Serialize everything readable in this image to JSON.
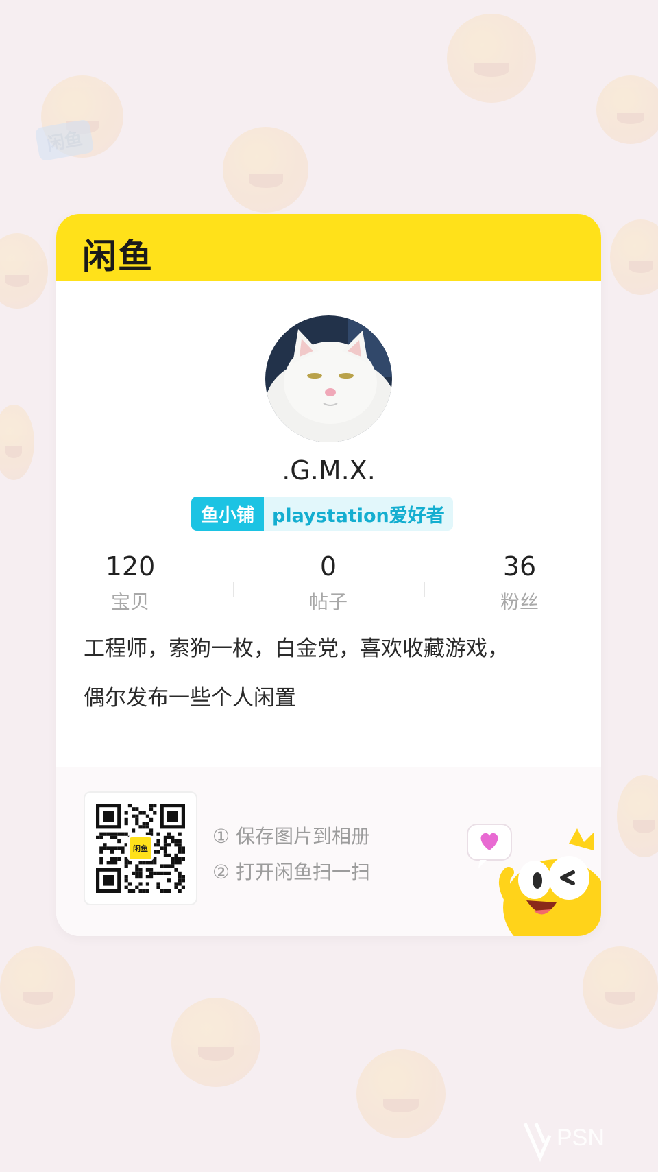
{
  "brand": {
    "name": "闲鱼",
    "bg_tag": "闲鱼"
  },
  "profile": {
    "username": ".G.M.X.",
    "badge_shop": "鱼小铺",
    "badge_tag": "playstation爱好者"
  },
  "stats": [
    {
      "value": "120",
      "label": "宝贝"
    },
    {
      "value": "0",
      "label": "帖子"
    },
    {
      "value": "36",
      "label": "粉丝"
    }
  ],
  "bio": {
    "line1": "工程师，索狗一枚，白金党，喜欢收藏游戏，",
    "line2": "偶尔发布一些个人闲置"
  },
  "footer": {
    "step1": "① 保存图片到相册",
    "step2": "② 打开闲鱼扫一扫",
    "qr_label": "闲鱼"
  },
  "watermark": {
    "text": "PSN"
  },
  "colors": {
    "brand_yellow": "#ffe11a",
    "badge_cyan": "#1cc3e3",
    "page_bg": "#f6eef1"
  },
  "icons": {
    "avatar": "white-cat-avatar",
    "mascot": "yellow-fish-mascot-icon",
    "heart": "heart-bubble-icon"
  }
}
